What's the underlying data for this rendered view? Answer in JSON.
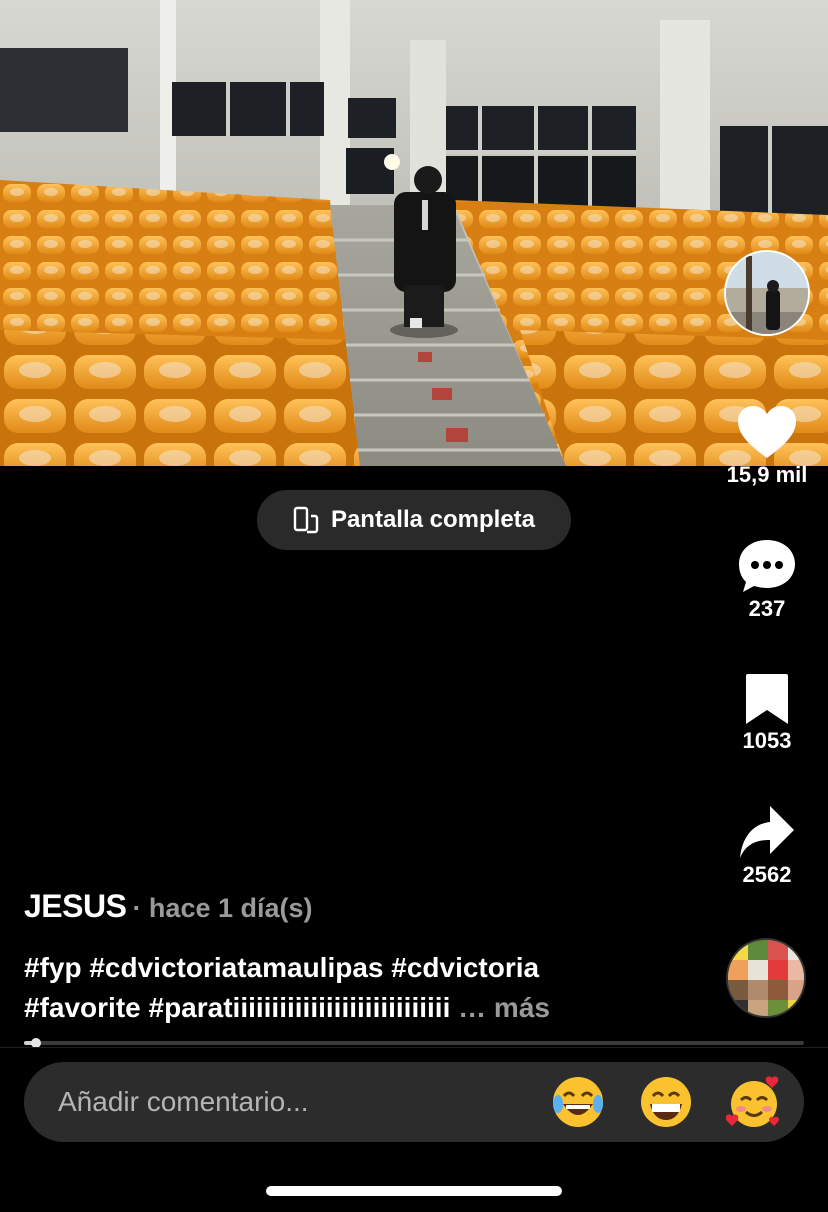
{
  "video": {
    "scene": "stadium-stairs"
  },
  "fullscreen_button": {
    "label": "Pantalla completa",
    "icon": "rotate-phone-icon"
  },
  "actions": {
    "likes": "15,9 mil",
    "comments": "237",
    "saves": "1053",
    "shares": "2562"
  },
  "post": {
    "author": "JESUS",
    "time": "· hace 1 día(s)",
    "caption_line1": "#fyp #cdvictoriatamaulipas  #cdvictoria",
    "caption_line2": "#favorite #paratiiiiiiiiiiiiiiiiiiiiiiiiiiii",
    "more_label": "… más"
  },
  "progress": {
    "fraction": 0.015
  },
  "comment": {
    "placeholder": "Añadir comentario...",
    "emojis": [
      "laughing-tears-emoji",
      "grinning-emoji",
      "smiling-hearts-emoji"
    ]
  },
  "colors": {
    "seat_orange": "#f7a12a",
    "pill_bg": "#2a2a2a",
    "comment_bg": "#2c2c2c",
    "muted_text": "#9a9a9a"
  }
}
